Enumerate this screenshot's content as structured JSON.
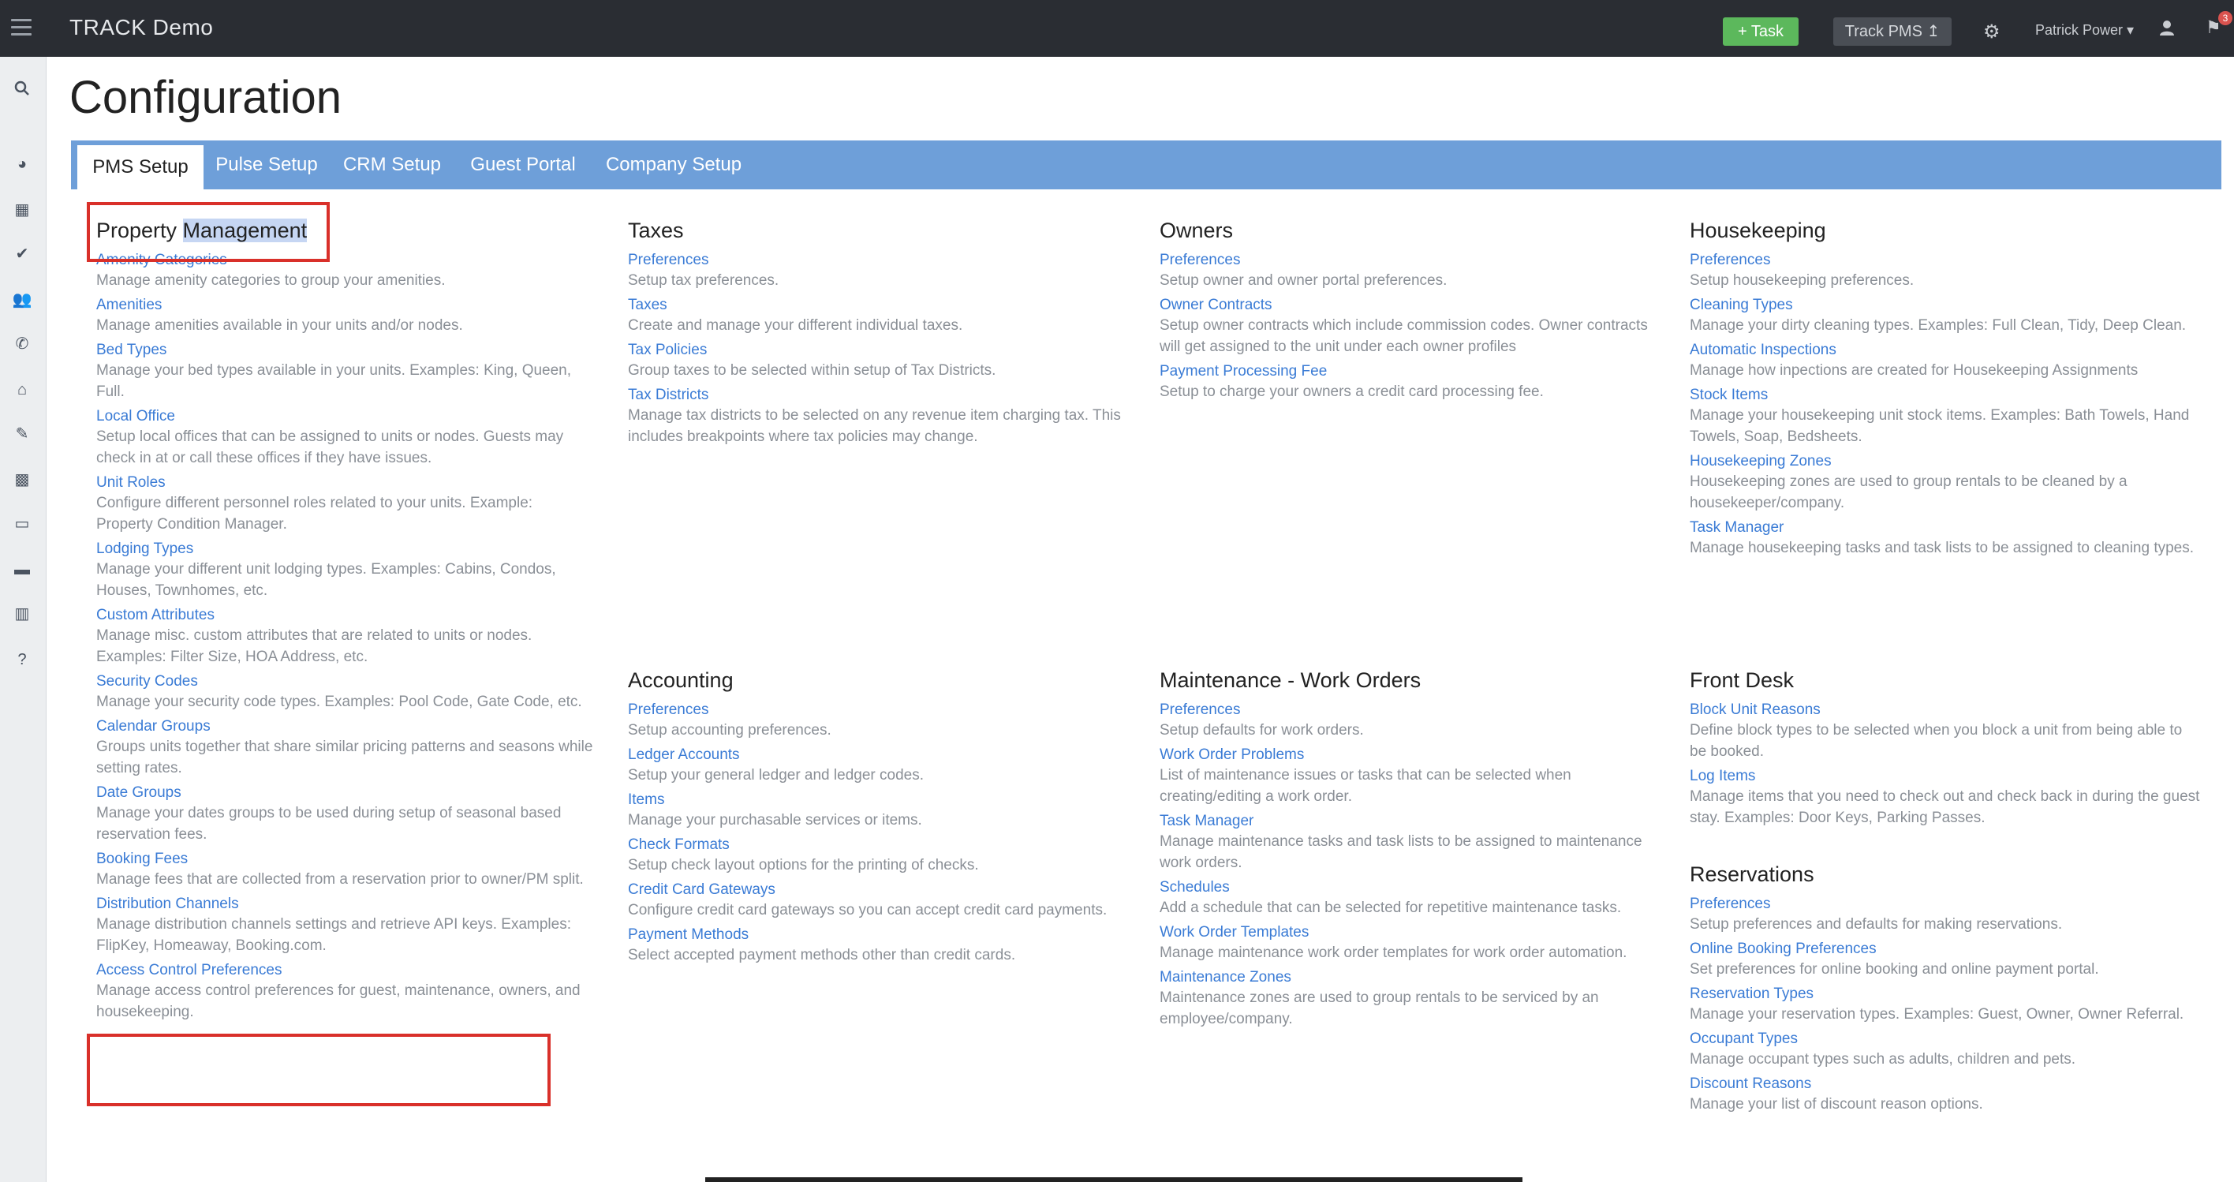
{
  "app": {
    "title": "TRACK Demo",
    "task_button": "+ Task",
    "track_pms_button": "Track PMS ↥",
    "user_name": "Patrick Power ▾",
    "notification_count": "3"
  },
  "icons": {
    "menu": "hamburger-icon",
    "settings": "gear-icon",
    "user": "user-icon",
    "notifications": "flag-icon",
    "sidebar": [
      "search-icon",
      "dashboard-icon",
      "calendar-icon",
      "check-circle-icon",
      "users-icon",
      "phone-icon",
      "home-icon",
      "wrench-icon",
      "grid-icon",
      "money-icon",
      "briefcase-icon",
      "chart-icon",
      "help-icon"
    ]
  },
  "page": {
    "title": "Configuration"
  },
  "tabs": [
    "PMS Setup",
    "Pulse Setup",
    "CRM Setup",
    "Guest Portal",
    "Company Setup"
  ],
  "active_tab": "PMS Setup",
  "sections": {
    "property_management": {
      "title_part1": "Property ",
      "title_part2": "Management",
      "items": [
        {
          "label": "Amenity Categories",
          "desc": "Manage amenity categories to group your amenities."
        },
        {
          "label": "Amenities",
          "desc": "Manage amenities available in your units and/or nodes."
        },
        {
          "label": "Bed Types",
          "desc": "Manage your bed types available in your units. Examples: King, Queen, Full."
        },
        {
          "label": "Local Office",
          "desc": "Setup local offices that can be assigned to units or nodes. Guests may check in at or call these offices if they have issues."
        },
        {
          "label": "Unit Roles",
          "desc": "Configure different personnel roles related to your units. Example: Property Condition Manager."
        },
        {
          "label": "Lodging Types",
          "desc": "Manage your different unit lodging types. Examples: Cabins, Condos, Houses, Townhomes, etc."
        },
        {
          "label": "Custom Attributes",
          "desc": "Manage misc. custom attributes that are related to units or nodes. Examples: Filter Size, HOA Address, etc."
        },
        {
          "label": "Security Codes",
          "desc": "Manage your security code types. Examples: Pool Code, Gate Code, etc."
        },
        {
          "label": "Calendar Groups",
          "desc": "Groups units together that share similar pricing patterns and seasons while setting rates."
        },
        {
          "label": "Date Groups",
          "desc": "Manage your dates groups to be used during setup of seasonal based reservation fees."
        },
        {
          "label": "Booking Fees",
          "desc": "Manage fees that are collected from a reservation prior to owner/PM split."
        },
        {
          "label": "Distribution Channels",
          "desc": "Manage distribution channels settings and retrieve API keys. Examples: FlipKey, Homeaway, Booking.com."
        },
        {
          "label": "Access Control Preferences",
          "desc": "Manage access control preferences for guest, maintenance, owners, and housekeeping."
        }
      ]
    },
    "taxes": {
      "title": "Taxes",
      "items": [
        {
          "label": "Preferences",
          "desc": "Setup tax preferences."
        },
        {
          "label": "Taxes",
          "desc": "Create and manage your different individual taxes."
        },
        {
          "label": "Tax Policies",
          "desc": "Group taxes to be selected within setup of Tax Districts."
        },
        {
          "label": "Tax Districts",
          "desc": "Manage tax districts to be selected on any revenue item charging tax. This includes breakpoints where tax policies may change."
        }
      ]
    },
    "accounting": {
      "title": "Accounting",
      "items": [
        {
          "label": "Preferences",
          "desc": "Setup accounting preferences."
        },
        {
          "label": "Ledger Accounts",
          "desc": "Setup your general ledger and ledger codes."
        },
        {
          "label": "Items",
          "desc": "Manage your purchasable services or items."
        },
        {
          "label": "Check Formats",
          "desc": "Setup check layout options for the printing of checks."
        },
        {
          "label": "Credit Card Gateways",
          "desc": "Configure credit card gateways so you can accept credit card payments."
        },
        {
          "label": "Payment Methods",
          "desc": "Select accepted payment methods other than credit cards."
        }
      ]
    },
    "owners": {
      "title": "Owners",
      "items": [
        {
          "label": "Preferences",
          "desc": "Setup owner and owner portal preferences."
        },
        {
          "label": "Owner Contracts",
          "desc": "Setup owner contracts which include commission codes. Owner contracts will get assigned to the unit under each owner profiles"
        },
        {
          "label": "Payment Processing Fee",
          "desc": "Setup to charge your owners a credit card processing fee."
        }
      ]
    },
    "maintenance": {
      "title": "Maintenance - Work Orders",
      "items": [
        {
          "label": "Preferences",
          "desc": "Setup defaults for work orders."
        },
        {
          "label": "Work Order Problems",
          "desc": "List of maintenance issues or tasks that can be selected when creating/editing a work order."
        },
        {
          "label": "Task Manager",
          "desc": "Manage maintenance tasks and task lists to be assigned to maintenance work orders."
        },
        {
          "label": "Schedules",
          "desc": "Add a schedule that can be selected for repetitive maintenance tasks."
        },
        {
          "label": "Work Order Templates",
          "desc": "Manage maintenance work order templates for work order automation."
        },
        {
          "label": "Maintenance Zones",
          "desc": "Maintenance zones are used to group rentals to be serviced by an employee/company."
        }
      ]
    },
    "housekeeping": {
      "title": "Housekeeping",
      "items": [
        {
          "label": "Preferences",
          "desc": "Setup housekeeping preferences."
        },
        {
          "label": "Cleaning Types",
          "desc": "Manage your dirty cleaning types. Examples: Full Clean, Tidy, Deep Clean."
        },
        {
          "label": "Automatic Inspections",
          "desc": "Manage how inpections are created for Housekeeping Assignments"
        },
        {
          "label": "Stock Items",
          "desc": "Manage your housekeeping unit stock items. Examples: Bath Towels, Hand Towels, Soap, Bedsheets."
        },
        {
          "label": "Housekeeping Zones",
          "desc": "Housekeeping zones are used to group rentals to be cleaned by a housekeeper/company."
        },
        {
          "label": "Task Manager",
          "desc": "Manage housekeeping tasks and task lists to be assigned to cleaning types."
        }
      ]
    },
    "front_desk": {
      "title": "Front Desk",
      "items": [
        {
          "label": "Block Unit Reasons",
          "desc": "Define block types to be selected when you block a unit from being able to be booked."
        },
        {
          "label": "Log Items",
          "desc": "Manage items that you need to check out and check back in during the guest stay. Examples: Door Keys, Parking Passes."
        }
      ]
    },
    "reservations": {
      "title": "Reservations",
      "items": [
        {
          "label": "Preferences",
          "desc": "Setup preferences and defaults for making reservations."
        },
        {
          "label": "Online Booking Preferences",
          "desc": "Set preferences for online booking and online payment portal."
        },
        {
          "label": "Reservation Types",
          "desc": "Manage your reservation types. Examples: Guest, Owner, Owner Referral."
        },
        {
          "label": "Occupant Types",
          "desc": "Manage occupant types such as adults, children and pets."
        },
        {
          "label": "Discount Reasons",
          "desc": "Manage your list of discount reason options."
        }
      ]
    }
  },
  "colors": {
    "topbar": "#2a2d33",
    "tabbar": "#6e9fd9",
    "link": "#3a7bd5",
    "description": "#8a8f96",
    "task_button": "#5cb85c",
    "highlight_box": "#d9302a"
  }
}
